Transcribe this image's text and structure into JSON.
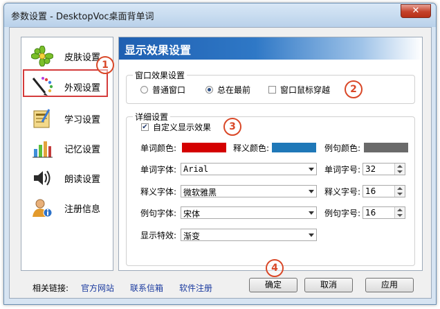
{
  "window": {
    "title": "参数设置 - DesktopVoc桌面背单词",
    "close_label": "✕"
  },
  "sidebar": {
    "items": [
      {
        "label": "皮肤设置",
        "icon": "flower-icon"
      },
      {
        "label": "外观设置",
        "icon": "pen-palette-icon",
        "selected": true
      },
      {
        "label": "学习设置",
        "icon": "notebook-icon"
      },
      {
        "label": "记忆设置",
        "icon": "chart-icon"
      },
      {
        "label": "朗读设置",
        "icon": "speaker-icon"
      },
      {
        "label": "注册信息",
        "icon": "user-info-icon"
      }
    ]
  },
  "panel": {
    "title": "显示效果设置",
    "window_effect": {
      "group_title": "窗口效果设置",
      "radio_normal": "普通窗口",
      "radio_topmost": "总在最前",
      "check_passthrough": "窗口鼠标穿越",
      "selected": "总在最前",
      "passthrough_checked": false
    },
    "details": {
      "group_title": "详细设置",
      "custom_effect": {
        "label": "自定义显示效果",
        "checked": true
      },
      "word_color_label": "单词颜色:",
      "meaning_color_label": "释义颜色:",
      "example_color_label": "例句颜色:",
      "word_color": "#d40000",
      "meaning_color": "#1f78b8",
      "example_color": "#6a6a6a",
      "word_font_label": "单词字体:",
      "word_font_value": "Arial",
      "word_size_label": "单词字号:",
      "word_size_value": "32",
      "meaning_font_label": "释义字体:",
      "meaning_font_value": "微软雅黑",
      "meaning_size_label": "释义字号:",
      "meaning_size_value": "16",
      "example_font_label": "例句字体:",
      "example_font_value": "宋体",
      "example_size_label": "例句字号:",
      "example_size_value": "16",
      "effect_label": "显示特效:",
      "effect_value": "渐变"
    }
  },
  "annotations": {
    "n1": "1",
    "n2": "2",
    "n3": "3",
    "n4": "4"
  },
  "footer": {
    "links_label": "相关链接:",
    "link_site": "官方网站",
    "link_mail": "联系信箱",
    "link_register": "软件注册",
    "ok": "确定",
    "cancel": "取消",
    "apply": "应用"
  },
  "colors": {
    "accent_blue": "#2f78c6",
    "highlight_red": "#d43b3b",
    "annotation_orange": "#d94727"
  }
}
